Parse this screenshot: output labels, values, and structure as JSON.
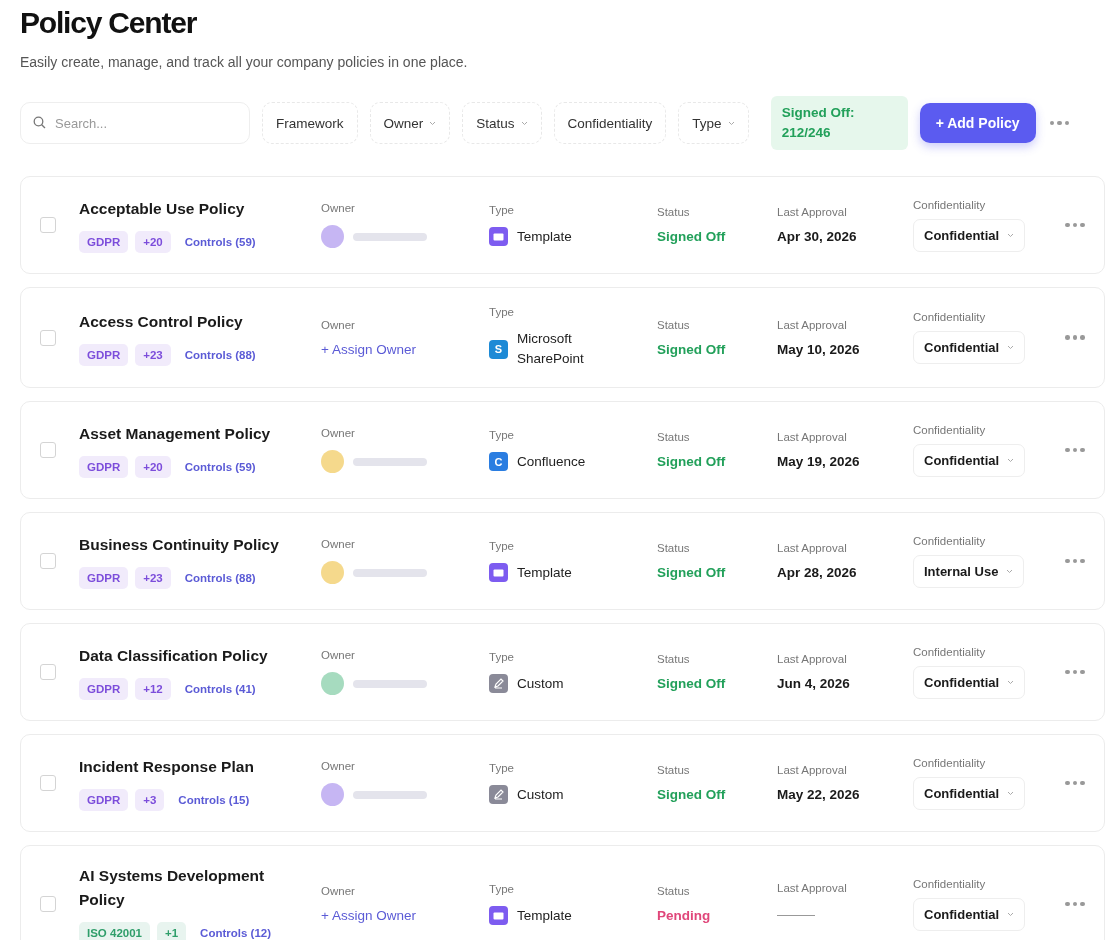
{
  "header": {
    "title": "Policy Center",
    "subtitle": "Easily create, manage, and track all your company policies in one place."
  },
  "toolbar": {
    "search": {
      "placeholder": "Search..."
    },
    "filters": [
      {
        "label": "Framework",
        "dropdown": false
      },
      {
        "label": "Owner",
        "dropdown": true
      },
      {
        "label": "Status",
        "dropdown": true
      },
      {
        "label": "Confidentiality",
        "dropdown": false
      },
      {
        "label": "Type",
        "dropdown": true
      }
    ],
    "summary": "Signed Off: 212/246",
    "add_button": "+ Add Policy"
  },
  "policies": [
    {
      "name": "Acceptable Use Policy",
      "checked": false,
      "framework": {
        "label": "GDPR",
        "color": "#7c4ddb"
      },
      "extra": "+20",
      "controls": "Controls (59)",
      "headings": [
        "Owner",
        "Type",
        "Status",
        "Last Approval",
        "Confidentiality"
      ],
      "owner": {
        "kind": "avatar",
        "color": "#c6b6f3"
      },
      "type": {
        "kind": "template",
        "label": "Template"
      },
      "status": {
        "kind": "signed",
        "label": "Signed Off"
      },
      "last_approval": "Apr 30, 2026",
      "confidentiality": "Confidential"
    },
    {
      "name": "Access Control Policy",
      "checked": false,
      "framework": {
        "label": "GDPR",
        "color": "#7c4ddb"
      },
      "extra": "+23",
      "controls": "Controls (88)",
      "headings": [
        "Owner",
        "Type",
        "Status",
        "Last Approval",
        "Confidentiality"
      ],
      "owner": {
        "kind": "assign",
        "label": "+ Assign Owner"
      },
      "type": {
        "kind": "sharepoint",
        "icon_text": "S",
        "label": "Microsoft SharePoint"
      },
      "status": {
        "kind": "signed",
        "label": "Signed Off"
      },
      "last_approval": "May 10, 2026",
      "confidentiality": "Confidential"
    },
    {
      "name": "Asset Management Policy",
      "checked": false,
      "framework": {
        "label": "GDPR",
        "color": "#7c4ddb"
      },
      "extra": "+20",
      "controls": "Controls (59)",
      "headings": [
        "Owner",
        "Type",
        "Status",
        "Last Approval",
        "Confidentiality"
      ],
      "owner": {
        "kind": "avatar",
        "color": "#f5d98c"
      },
      "type": {
        "kind": "confluence",
        "icon_text": "C",
        "label": "Confluence"
      },
      "status": {
        "kind": "signed",
        "label": "Signed Off"
      },
      "last_approval": "May 19, 2026",
      "confidentiality": "Confidential"
    },
    {
      "name": "Business Continuity Policy",
      "checked": false,
      "framework": {
        "label": "GDPR",
        "color": "#7c4ddb"
      },
      "extra": "+23",
      "controls": "Controls (88)",
      "headings": [
        "Owner",
        "Type",
        "Status",
        "Last Approval",
        "Confidentiality"
      ],
      "owner": {
        "kind": "avatar",
        "color": "#f5d98c"
      },
      "type": {
        "kind": "template",
        "label": "Template"
      },
      "status": {
        "kind": "signed",
        "label": "Signed Off"
      },
      "last_approval": "Apr 28, 2026",
      "confidentiality": "Internal Use"
    },
    {
      "name": "Data Classification Policy",
      "checked": false,
      "framework": {
        "label": "GDPR",
        "color": "#7c4ddb"
      },
      "extra": "+12",
      "controls": "Controls (41)",
      "headings": [
        "Owner",
        "Type",
        "Status",
        "Last Approval",
        "Confidentiality"
      ],
      "owner": {
        "kind": "avatar",
        "color": "#a6dbbf"
      },
      "type": {
        "kind": "custom",
        "label": "Custom"
      },
      "status": {
        "kind": "signed",
        "label": "Signed Off"
      },
      "last_approval": "Jun 4, 2026",
      "confidentiality": "Confidential"
    },
    {
      "name": "Incident Response Plan",
      "checked": false,
      "framework": {
        "label": "GDPR",
        "color": "#7c4ddb"
      },
      "extra": "+3",
      "controls": "Controls (15)",
      "headings": [
        "Owner",
        "Type",
        "Status",
        "Last Approval",
        "Confidentiality"
      ],
      "owner": {
        "kind": "avatar",
        "color": "#c6b6f3"
      },
      "type": {
        "kind": "custom",
        "label": "Custom"
      },
      "status": {
        "kind": "signed",
        "label": "Signed Off"
      },
      "last_approval": "May 22, 2026",
      "confidentiality": "Confidential"
    },
    {
      "name": "AI Systems Development Policy",
      "checked": false,
      "framework": {
        "label": "ISO 42001",
        "color": "#2f9e6a"
      },
      "extra": "+1",
      "controls": "Controls (12)",
      "headings": [
        "Owner",
        "Type",
        "Status",
        "Last Approval",
        "Confidentiality"
      ],
      "owner": {
        "kind": "assign",
        "label": "+ Assign Owner"
      },
      "type": {
        "kind": "template",
        "label": "Template"
      },
      "status": {
        "kind": "pending",
        "label": "Pending"
      },
      "confidentiality": "Confidential"
    }
  ]
}
